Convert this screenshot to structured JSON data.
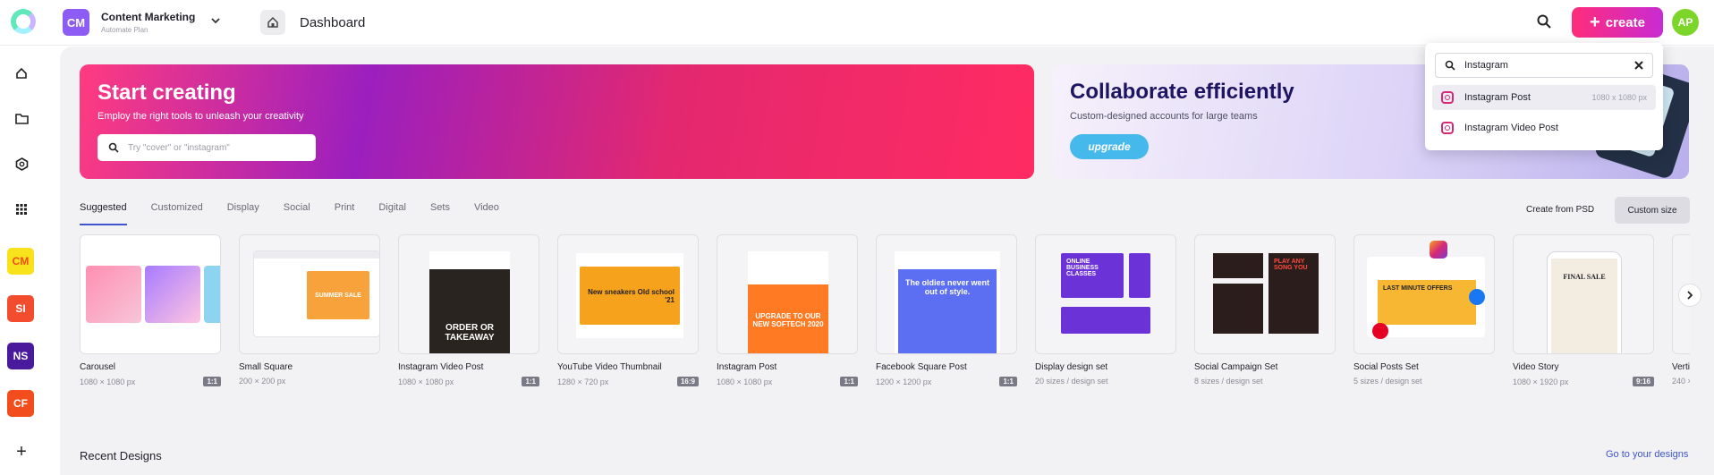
{
  "header": {
    "workspace_initials": "CM",
    "workspace_name": "Content Marketing",
    "workspace_plan": "Automate Plan",
    "page_title": "Dashboard",
    "create_label": "create",
    "user_initials": "AP"
  },
  "sidebar": {
    "workspaces": [
      {
        "initials": "CM",
        "color": "#f7e21c"
      },
      {
        "initials": "SI",
        "color": "#f24d2e"
      },
      {
        "initials": "NS",
        "color": "#4a1a9c"
      },
      {
        "initials": "CF",
        "color": "#f24d1c"
      }
    ]
  },
  "hero": {
    "title": "Start creating",
    "subtitle": "Employ the right tools to unleash your creativity",
    "search_placeholder": "Try \"cover\" or \"instagram\""
  },
  "promo": {
    "title": "Collaborate efficiently",
    "subtitle": "Custom-designed accounts for large teams",
    "button": "upgrade"
  },
  "tabs": [
    "Suggested",
    "Customized",
    "Display",
    "Social",
    "Print",
    "Digital",
    "Sets",
    "Video"
  ],
  "actions": {
    "create_from_psd": "Create from PSD",
    "custom_size": "Custom size"
  },
  "cards": [
    {
      "name": "Carousel",
      "meta": "1080 × 1080 px",
      "ratio": "1:1"
    },
    {
      "name": "Small Square",
      "meta": "200 × 200 px",
      "ratio": ""
    },
    {
      "name": "Instagram Video Post",
      "meta": "1080 × 1080 px",
      "ratio": "1:1"
    },
    {
      "name": "YouTube Video Thumbnail",
      "meta": "1280 × 720 px",
      "ratio": "16:9"
    },
    {
      "name": "Instagram Post",
      "meta": "1080 × 1080 px",
      "ratio": "1:1"
    },
    {
      "name": "Facebook Square Post",
      "meta": "1200 × 1200 px",
      "ratio": "1:1"
    },
    {
      "name": "Display design set",
      "meta": "20 sizes / design set",
      "ratio": ""
    },
    {
      "name": "Social Campaign Set",
      "meta": "8 sizes / design set",
      "ratio": ""
    },
    {
      "name": "Social Posts Set",
      "meta": "5 sizes / design set",
      "ratio": ""
    },
    {
      "name": "Video Story",
      "meta": "1080 × 1920 px",
      "ratio": "9:16"
    },
    {
      "name": "Verti",
      "meta": "240 ×",
      "ratio": ""
    }
  ],
  "thumb_text": {
    "small_square": "SUMMER SALE",
    "ig_video": "ORDER OR TAKEAWAY",
    "youtube": "New sneakers Old school '21",
    "ig_post": "UPGRADE TO OUR NEW SOFTECH 2020",
    "facebook": "The oldies never went out of style.",
    "display": "ONLINE BUSINESS CLASSES",
    "campaign": "PLAY ANY SONG YOU",
    "posts": "LAST MINUTE OFFERS",
    "story": "FINAL SALE"
  },
  "search_dropdown": {
    "query": "Instagram",
    "results": [
      {
        "label": "Instagram Post",
        "size": "1080 x 1080 px"
      },
      {
        "label": "Instagram Video Post",
        "size": ""
      }
    ]
  },
  "recent": {
    "title": "Recent Designs",
    "link": "Go to your designs"
  }
}
